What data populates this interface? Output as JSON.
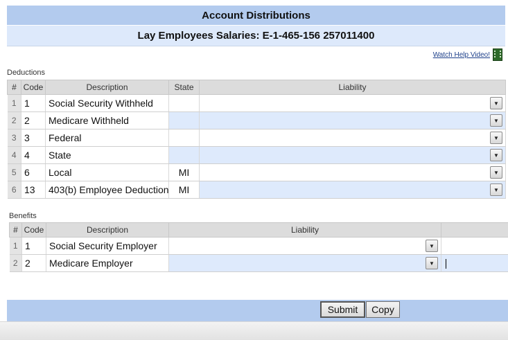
{
  "header": {
    "title": "Account Distributions",
    "subtitle": "Lay Employees Salaries: E-1-465-156 257011400"
  },
  "help": {
    "link_text": "Watch Help Video!"
  },
  "deductions": {
    "label": "Deductions",
    "columns": {
      "num": "#",
      "code": "Code",
      "description": "Description",
      "state": "State",
      "liability": "Liability"
    },
    "rows": [
      {
        "num": "1",
        "code": "1",
        "description": "Social Security Withheld",
        "state": ""
      },
      {
        "num": "2",
        "code": "2",
        "description": "Medicare Withheld",
        "state": ""
      },
      {
        "num": "3",
        "code": "3",
        "description": "Federal",
        "state": ""
      },
      {
        "num": "4",
        "code": "4",
        "description": "State",
        "state": ""
      },
      {
        "num": "5",
        "code": "6",
        "description": "Local",
        "state": "MI"
      },
      {
        "num": "6",
        "code": "13",
        "description": "403(b) Employee Deduction",
        "state": "MI"
      }
    ]
  },
  "benefits": {
    "label": "Benefits",
    "columns": {
      "num": "#",
      "code": "Code",
      "description": "Description",
      "liability": "Liability",
      "extra": ""
    },
    "rows": [
      {
        "num": "1",
        "code": "1",
        "description": "Social Security Employer"
      },
      {
        "num": "2",
        "code": "2",
        "description": "Medicare Employer"
      }
    ]
  },
  "footer": {
    "submit_label": "Submit",
    "copy_label": "Copy"
  },
  "colors": {
    "header_bg": "#b3cbee",
    "row_highlight": "#deeafc"
  }
}
